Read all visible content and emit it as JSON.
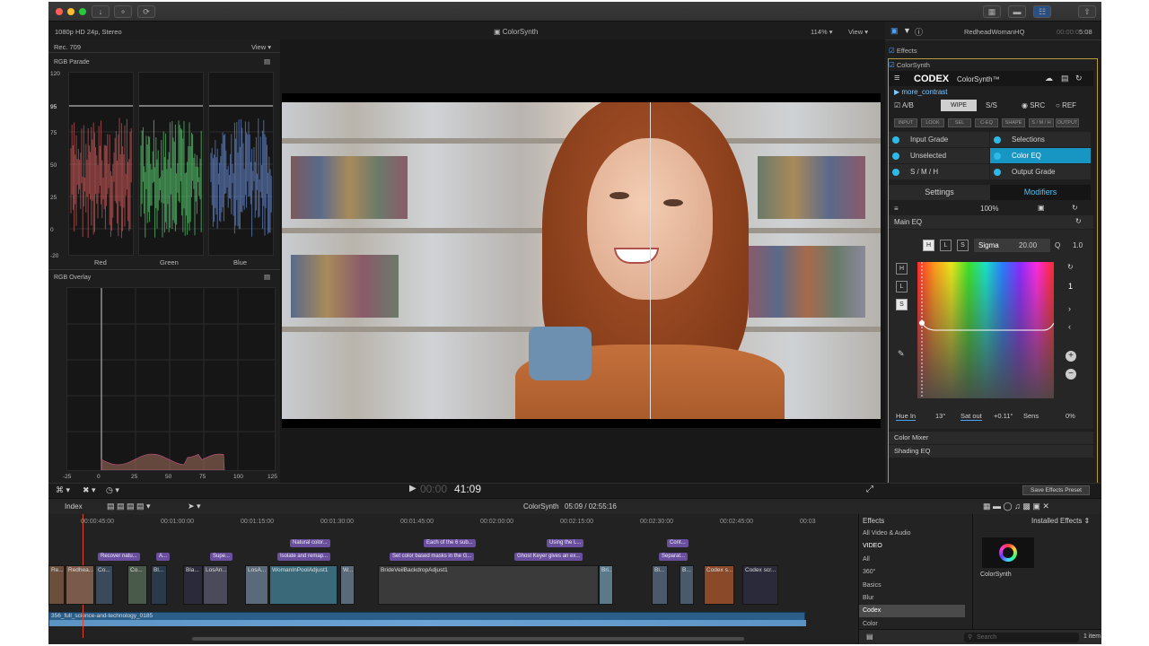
{
  "window": {
    "title": "ColorSynth"
  },
  "toolbar_left": {
    "format": "1080p HD 24p, Stereo"
  },
  "viewer": {
    "zoom": "114%",
    "view": "View",
    "timecode_prefix": "00:00",
    "timecode": "41:09"
  },
  "scopes": {
    "colorspace": "Rec. 709",
    "view": "View",
    "parade_title": "RGB Parade",
    "parade_ticks": [
      "120",
      "95",
      "75",
      "50",
      "25",
      "0",
      "-20"
    ],
    "parade_channels": [
      "Red",
      "Green",
      "Blue"
    ],
    "overlay_title": "RGB Overlay",
    "overlay_ticks": [
      "-25",
      "0",
      "25",
      "50",
      "75",
      "100",
      "125"
    ]
  },
  "inspector": {
    "clip_name": "RedheadWomanHQ",
    "clip_time_prefix": "00:00:0",
    "clip_time": "5:08",
    "effects_label": "Effects",
    "plugin_label": "ColorSynth",
    "brand": "CODEX",
    "product": "ColorSynth™",
    "preset": "more_contrast",
    "ab": "A/B",
    "wipe": "WIPE",
    "ss": "S/S",
    "src": "SRC",
    "ref": "REF",
    "chips": [
      "INPUT",
      "LOOK",
      "SEL",
      "C-EQ",
      "SHAPE",
      "S / M / H",
      "OUTPUT"
    ],
    "grid": [
      "Input Grade",
      "Selections",
      "Unselected",
      "Color EQ",
      "S / M / H",
      "Output Grade"
    ],
    "tabs": [
      "Settings",
      "Modifiers"
    ],
    "mix": "100%",
    "section": "Main EQ",
    "hls": [
      "H",
      "L",
      "S"
    ],
    "sigma_label": "Sigma",
    "sigma_value": "20.00",
    "q_label": "Q",
    "q_value": "1.0",
    "side_number": "1",
    "hue_in_label": "Hue In",
    "hue_in_value": "13°",
    "sat_out_label": "Sat out",
    "sat_out_value": "+0.11°",
    "sens_label": "Sens",
    "sens_value": "0%",
    "sections": [
      "Color Mixer",
      "Shading EQ"
    ],
    "save_preset": "Save Effects Preset"
  },
  "timeline": {
    "index": "Index",
    "project": "ColorSynth",
    "timecode": "05:09 / 02:55:16",
    "ruler": [
      "00:00:45:00",
      "00:01:00:00",
      "00:01:15:00",
      "00:01:30:00",
      "00:01:45:00",
      "00:02:00:00",
      "00:02:15:00",
      "00:02:30:00",
      "00:02:45:00",
      "00:03"
    ],
    "annotations": [
      "Natural color...",
      "Each of the 6 sub...",
      "Using the L...",
      "Cont...",
      "Recover natu...",
      "A...",
      "Supe...",
      "Isolate and remap...",
      "Set color based masks in the G...",
      "Ghost Keyer gives an ex...",
      "Separat..."
    ],
    "clips": [
      "Re...",
      "Redhea...",
      "Co...",
      "Co...",
      "Bl...",
      "Bla...",
      "LosAn...",
      "LosA...",
      "WomanInPoolAdjust1",
      "W...",
      "BrideVeilBackdropAdjust1",
      "Bri...",
      "Bl...",
      "B...",
      "Codex s...",
      "Codex scr..."
    ],
    "audio_clip": "356_full_science-and-technology_0185"
  },
  "effects_browser": {
    "title": "Effects",
    "installed": "Installed Effects",
    "categories": [
      "All Video & Audio",
      "VIDEO",
      "All",
      "360°",
      "Basics",
      "Blur",
      "Codex",
      "Color"
    ],
    "selected_category": "Codex",
    "item": "ColorSynth",
    "search_placeholder": "Search",
    "count": "1 item"
  }
}
